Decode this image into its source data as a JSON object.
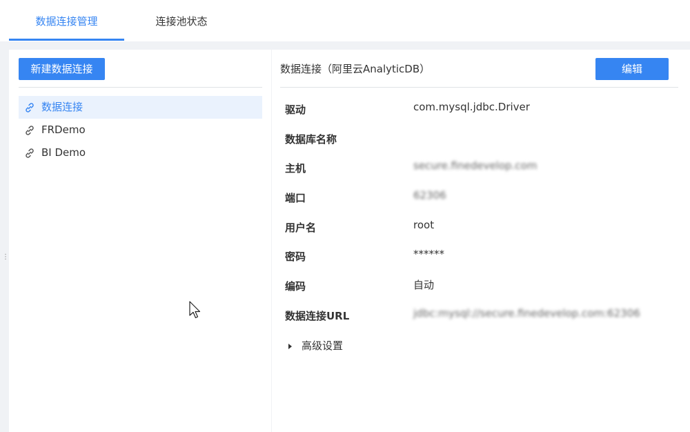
{
  "tabs": [
    {
      "label": "数据连接管理",
      "active": true
    },
    {
      "label": "连接池状态",
      "active": false
    }
  ],
  "left": {
    "new_button": "新建数据连接",
    "connections": [
      {
        "name": "数据连接",
        "active": true,
        "icon": "link-icon"
      },
      {
        "name": "FRDemo",
        "active": false,
        "icon": "link-icon"
      },
      {
        "name": "BI Demo",
        "active": false,
        "icon": "link-icon"
      }
    ]
  },
  "right": {
    "title": "数据连接（阿里云AnalyticDB）",
    "edit_button": "编辑",
    "properties": [
      {
        "label": "驱动",
        "value": "com.mysql.jdbc.Driver",
        "blurred": false
      },
      {
        "label": "数据库名称",
        "value": "",
        "blurred": false
      },
      {
        "label": "主机",
        "value": "secure.finedevelop.com",
        "blurred": true
      },
      {
        "label": "端口",
        "value": "62306",
        "blurred": true
      },
      {
        "label": "用户名",
        "value": "root",
        "blurred": false
      },
      {
        "label": "密码",
        "value": "******",
        "blurred": false
      },
      {
        "label": "编码",
        "value": "自动",
        "blurred": false
      },
      {
        "label": "数据连接URL",
        "value": "jdbc:mysql://secure.finedevelop.com:62306",
        "blurred": true
      }
    ],
    "advanced_label": "高级设置"
  },
  "colors": {
    "accent": "#3685f2",
    "active_bg": "#eaf2fd",
    "page_bg": "#f0f2f5"
  }
}
